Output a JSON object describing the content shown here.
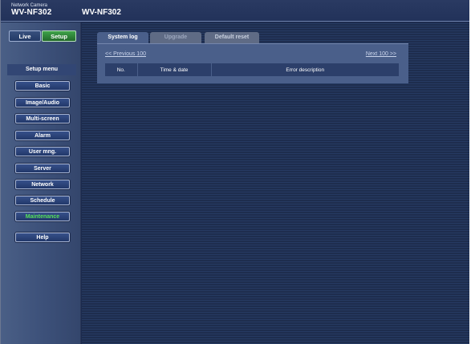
{
  "header": {
    "brand_small": "Network Camera",
    "brand_model": "WV-NF302",
    "title": "WV-NF302"
  },
  "mode": {
    "live_label": "Live",
    "setup_label": "Setup"
  },
  "sidebar": {
    "menu_label": "Setup menu",
    "items": [
      {
        "label": "Basic"
      },
      {
        "label": "Image/Audio"
      },
      {
        "label": "Multi-screen"
      },
      {
        "label": "Alarm"
      },
      {
        "label": "User mng."
      },
      {
        "label": "Server"
      },
      {
        "label": "Network"
      },
      {
        "label": "Schedule"
      },
      {
        "label": "Maintenance",
        "active": true
      },
      {
        "label": "Help"
      }
    ]
  },
  "main": {
    "tabs": [
      {
        "label": "System log",
        "active": true
      },
      {
        "label": "Upgrade"
      },
      {
        "label": "Default reset"
      }
    ],
    "prev_link": "<< Previous 100",
    "next_link": "Next 100  >>",
    "table": {
      "columns": [
        "No.",
        "Time & date",
        "Error description"
      ]
    }
  },
  "colors": {
    "background": "#1b2a4e",
    "panel": "#4a5f8a",
    "active_menu_text": "#55e05a",
    "setup_green": "#3fa34a"
  }
}
